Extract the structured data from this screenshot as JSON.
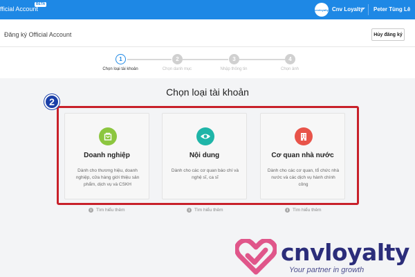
{
  "app": {
    "title": "fficial Account",
    "badge": "BETA",
    "account_logo_text": "cnvloyalty",
    "account_name": "Cnv Loyalty",
    "user_name": "Peter Tùng Lê"
  },
  "header": {
    "title": "Đăng ký Official Account",
    "cancel_label": "Hủy đăng ký"
  },
  "stepper": {
    "steps": [
      {
        "number": "1",
        "label": "Chọn loại tài khoản",
        "active": true
      },
      {
        "number": "2",
        "label": "Chọn danh mục",
        "active": false
      },
      {
        "number": "3",
        "label": "Nhập thông tin",
        "active": false
      },
      {
        "number": "4",
        "label": "Chọn ảnh",
        "active": false
      }
    ]
  },
  "main": {
    "heading": "Chọn loại tài khoản",
    "annotation_number": "2",
    "learn_more_label": "Tìm hiểu thêm",
    "cards": [
      {
        "title": "Doanh nghiệp",
        "description": "Dành cho thương hiệu, doanh nghiệp, cửa hàng giới thiệu sản phẩm, dịch vụ và CSKH",
        "icon": "bag-icon",
        "icon_color": "#8cc63f"
      },
      {
        "title": "Nội dung",
        "description": "Dành cho các cơ quan báo chí và nghệ sĩ, ca sĩ",
        "icon": "content-icon",
        "icon_color": "#1fb5a8"
      },
      {
        "title": "Cơ quan nhà nước",
        "description": "Dành cho các cơ quan, tổ chức nhà nước và các dịch vụ hành chính công",
        "icon": "building-icon",
        "icon_color": "#e8544a"
      }
    ]
  },
  "watermark": {
    "brand": "cnvloyalty",
    "tagline": "Your partner in growth",
    "heart_color": "#e0568a"
  },
  "colors": {
    "topbar": "#1e88e5",
    "highlight_border": "#c8202a",
    "annotation_badge": "#1a3fa8",
    "brand_text": "#2b2d7a"
  }
}
